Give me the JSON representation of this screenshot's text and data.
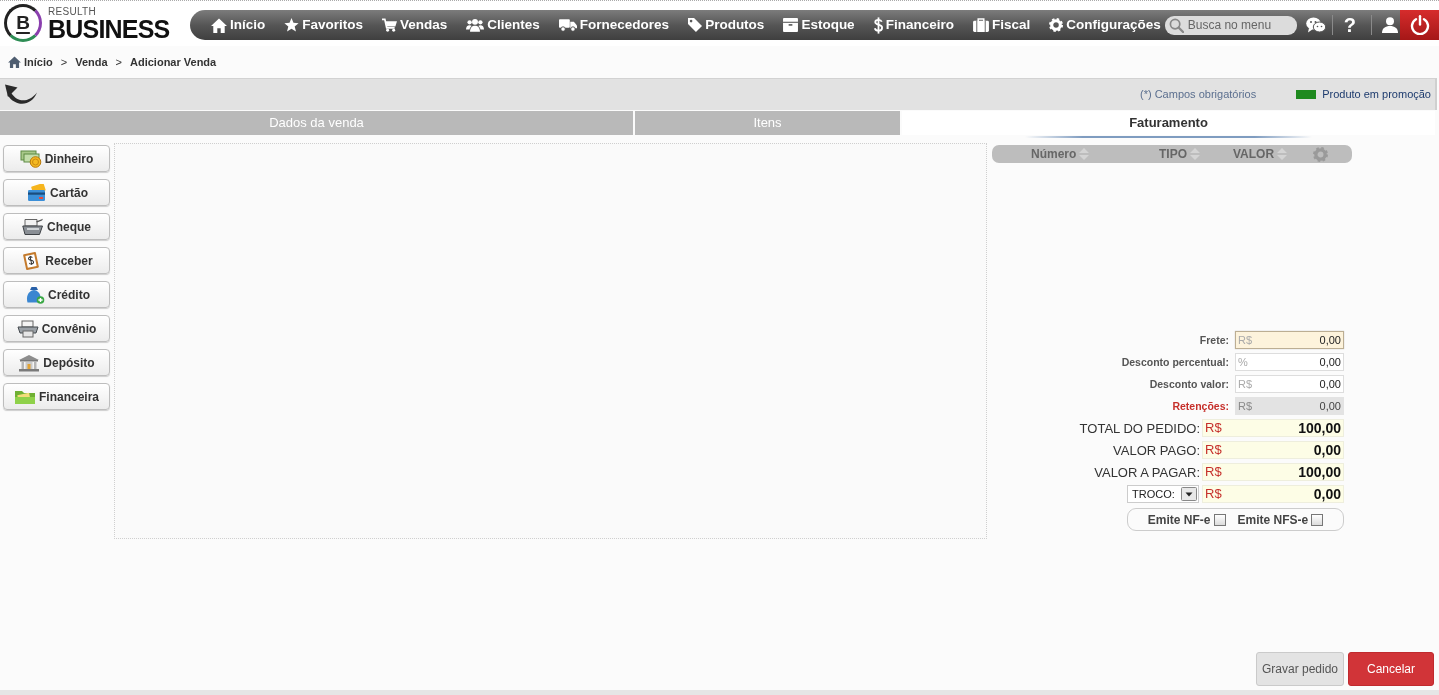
{
  "header": {
    "logo": {
      "mark": "B",
      "subtitle": "RESULTH",
      "name": "BUSINESS"
    },
    "menu": [
      "Início",
      "Favoritos",
      "Vendas",
      "Clientes",
      "Fornecedores",
      "Produtos",
      "Estoque",
      "Financeiro",
      "Fiscal",
      "Configurações"
    ],
    "search": {
      "placeholder": "Busca no menu"
    },
    "help": "?"
  },
  "breadcrumb": [
    {
      "kind": "link",
      "text": "Início"
    },
    {
      "kind": "separator",
      "text": ">"
    },
    {
      "kind": "link",
      "text": "Venda"
    },
    {
      "kind": "separator",
      "text": ">"
    },
    {
      "kind": "current",
      "text": "Adicionar Venda"
    }
  ],
  "toolbar": {
    "required_note": "(*) Campos obrigatórios",
    "legend_label": "Produto em promoção"
  },
  "tabs": [
    {
      "label": "Dados da venda",
      "selected": false
    },
    {
      "label": "Itens",
      "selected": false
    },
    {
      "label": "Faturamento",
      "selected": true
    }
  ],
  "payment_methods": [
    "Dinheiro",
    "Cartão",
    "Cheque",
    "Receber",
    "Crédito",
    "Convênio",
    "Depósito",
    "Financeira"
  ],
  "payments_table": {
    "columns": [
      "Número",
      "TIPO",
      "VALOR"
    ]
  },
  "adjustments": [
    {
      "label": "Frete:",
      "prefix": "R$",
      "value": "0,00",
      "focused": true,
      "disabled": false
    },
    {
      "label": "Desconto percentual:",
      "prefix": "%",
      "value": "0,00",
      "focused": false,
      "disabled": false
    },
    {
      "label": "Desconto valor:",
      "prefix": "R$",
      "value": "0,00",
      "focused": false,
      "disabled": false
    },
    {
      "label": "Retenções:",
      "prefix": "R$",
      "value": "0,00",
      "focused": false,
      "disabled": true
    }
  ],
  "totals": [
    {
      "label": "TOTAL DO PEDIDO:",
      "prefix": "R$",
      "value": "100,00"
    },
    {
      "label": "VALOR PAGO:",
      "prefix": "R$",
      "value": "0,00"
    },
    {
      "label": "VALOR A PAGAR:",
      "prefix": "R$",
      "value": "100,00"
    }
  ],
  "change": {
    "select": "TROCO:",
    "prefix": "R$",
    "value": "0,00"
  },
  "invoice_options": [
    {
      "label": "Emite NF-e",
      "checked": false
    },
    {
      "label": "Emite NFS-e",
      "checked": false
    }
  ],
  "actions": [
    {
      "label": "Gravar pedido",
      "kind": "secondary"
    },
    {
      "label": "Cancelar",
      "kind": "danger"
    }
  ]
}
